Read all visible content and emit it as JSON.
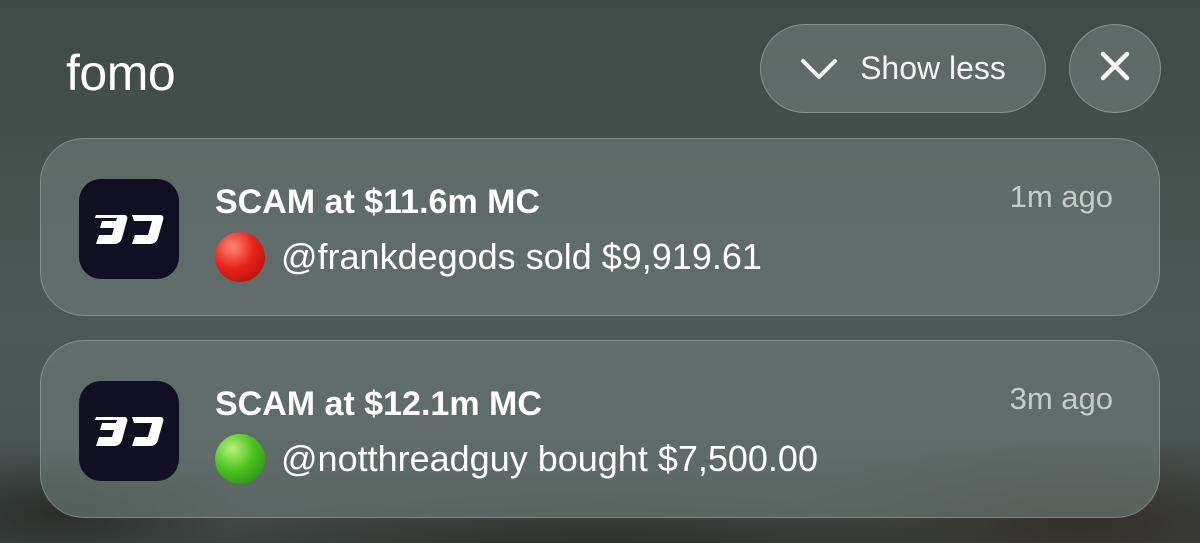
{
  "group": {
    "app_name": "fomo",
    "show_less_label": "Show less",
    "show_less_icon": "chevron-down-icon",
    "close_icon": "close-icon"
  },
  "notifications": [
    {
      "title": "SCAM at $11.6m MC",
      "time": "1m ago",
      "status_color": "#e8231a",
      "status_icon": "red-circle",
      "message": "@frankdegods sold $9,919.61"
    },
    {
      "title": "SCAM at $12.1m MC",
      "time": "3m ago",
      "status_color": "#4cc320",
      "status_icon": "green-circle",
      "message": "@notthreadguy bought $7,500.00"
    }
  ]
}
